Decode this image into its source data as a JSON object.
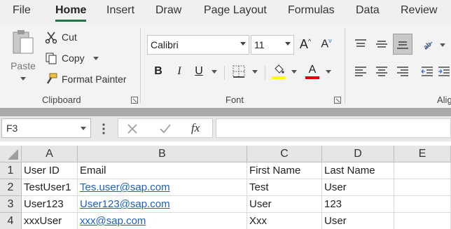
{
  "menu": {
    "tabs": [
      "File",
      "Home",
      "Insert",
      "Draw",
      "Page Layout",
      "Formulas",
      "Data",
      "Review"
    ],
    "active": "Home"
  },
  "ribbon": {
    "clipboard": {
      "paste_label": "Paste",
      "cut_label": "Cut",
      "copy_label": "Copy",
      "format_painter_label": "Format Painter",
      "group_label": "Clipboard"
    },
    "font": {
      "font_name": "Calibri",
      "font_size": "11",
      "group_label": "Font",
      "highlight_color": "#ffff00",
      "font_color": "#e00000"
    },
    "alignment": {
      "group_label_partial": "Alig"
    }
  },
  "formula_bar": {
    "name_box": "F3",
    "fx_label": "fx",
    "content": ""
  },
  "sheet": {
    "columns": [
      "A",
      "B",
      "C",
      "D",
      "E"
    ],
    "rows": [
      {
        "num": "1",
        "cells": [
          "User ID",
          "Email",
          "First Name",
          "Last Name",
          ""
        ]
      },
      {
        "num": "2",
        "cells": [
          "TestUser1",
          "Tes.user@sap.com",
          "Test",
          "User",
          ""
        ]
      },
      {
        "num": "3",
        "cells": [
          "User123",
          "User123@sap.com",
          "User",
          "123",
          ""
        ]
      },
      {
        "num": "4",
        "cells": [
          "xxxUser",
          "xxx@sap.com",
          "Xxx",
          "User",
          ""
        ]
      }
    ],
    "link_color": "#1f5fbf"
  }
}
